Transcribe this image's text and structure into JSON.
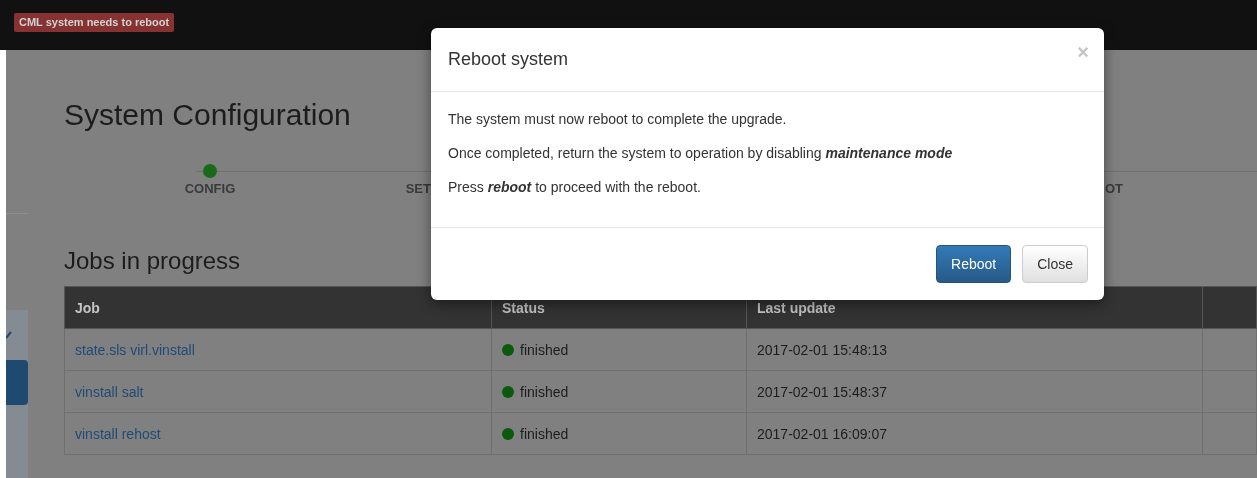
{
  "top_bar": {
    "alert_badge": "CML system needs to reboot"
  },
  "page": {
    "title": "System Configuration",
    "steps": [
      {
        "label": "CONFIG",
        "completed": true
      },
      {
        "label": "SET",
        "completed": false
      },
      {
        "label": "OT",
        "completed": false
      }
    ],
    "jobs": {
      "heading": "Jobs in progress",
      "columns": [
        "Job",
        "Status",
        "Last update"
      ],
      "rows": [
        {
          "job": "state.sls virl.vinstall",
          "status": "finished",
          "last_update": "2017-02-01 15:48:13"
        },
        {
          "job": "vinstall salt",
          "status": "finished",
          "last_update": "2017-02-01 15:48:37"
        },
        {
          "job": "vinstall rehost",
          "status": "finished",
          "last_update": "2017-02-01 16:09:07"
        }
      ]
    }
  },
  "modal": {
    "title": "Reboot system",
    "close": "×",
    "paragraphs": [
      "The system must now reboot to complete the upgrade.",
      "Once completed, return the system to operation by disabling **maintenance mode**",
      "Press **reboot** to proceed with the reboot."
    ],
    "buttons": [
      {
        "label": "Reboot",
        "kind": "primary"
      },
      {
        "label": "Close",
        "kind": "default"
      }
    ]
  }
}
